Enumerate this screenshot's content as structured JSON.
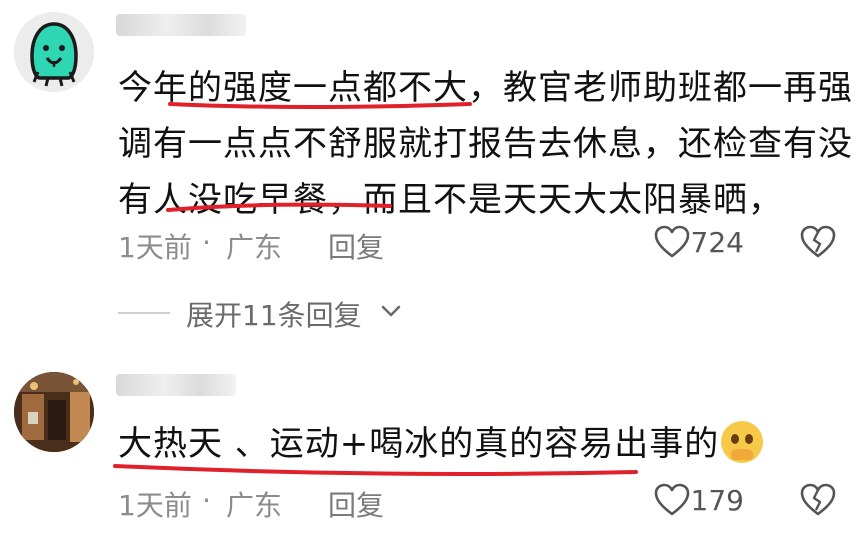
{
  "comments": [
    {
      "text_lines": [
        "今年的强度一点都不大，教官老师助班都一再强",
        "调有一点点不舒服就打报告去休息，还检查有没",
        "有人没吃早餐，而且不是天天大太阳暴晒，"
      ],
      "time": "1天前",
      "separator": "·",
      "location": "广东",
      "reply_label": "回复",
      "like_count": "724",
      "expand_label": "展开11条回复"
    },
    {
      "text_lines": [
        "大热天 、运动+喝冰的真的容易出事的"
      ],
      "time": "1天前",
      "separator": "·",
      "location": "广东",
      "reply_label": "回复",
      "like_count": "179"
    }
  ],
  "colors": {
    "annotation_underline": "#e0202a",
    "avatar1_bg": "#2fd6b4",
    "avatar1_outline": "#1a1a1a",
    "meta_text": "#8c8c8c"
  },
  "icons": {
    "like": "heart-outline-icon",
    "dislike": "broken-heart-icon",
    "expand": "chevron-down-icon",
    "emoji": "pleading-face-with-hands-emoji"
  }
}
